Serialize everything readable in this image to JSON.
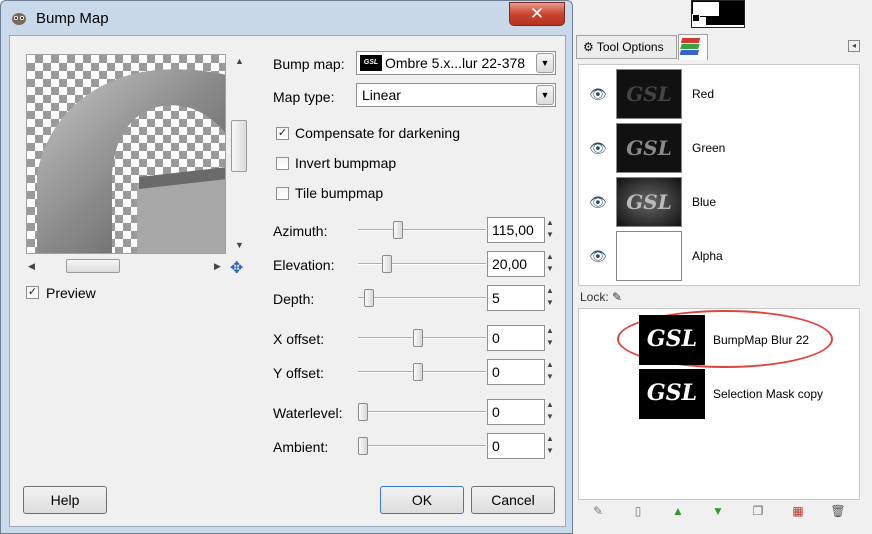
{
  "dialog": {
    "title": "Bump Map",
    "close_label": "✕",
    "preview_label": "Preview",
    "bump_map_label": "Bump map:",
    "bump_map_value": "Ombre 5.x...lur 22-378",
    "bump_thumb_text": "GSL",
    "map_type_label": "Map type:",
    "map_type_value": "Linear",
    "compensate_label": "Compensate for darkening",
    "invert_label": "Invert bumpmap",
    "tile_label": "Tile bumpmap",
    "azimuth_label": "Azimuth:",
    "azimuth_value": "115,00",
    "elevation_label": "Elevation:",
    "elevation_value": "20,00",
    "depth_label": "Depth:",
    "depth_value": "5",
    "xoffset_label": "X offset:",
    "xoffset_value": "0",
    "yoffset_label": "Y offset:",
    "yoffset_value": "0",
    "waterlevel_label": "Waterlevel:",
    "waterlevel_value": "0",
    "ambient_label": "Ambient:",
    "ambient_value": "0",
    "help_label": "Help",
    "ok_label": "OK",
    "cancel_label": "Cancel",
    "checks": {
      "preview": true,
      "compensate": true,
      "invert": false,
      "tile": false
    }
  },
  "panel": {
    "tab_tool_options": "Tool Options",
    "lock_label": "Lock:",
    "channels": [
      {
        "name": "Red"
      },
      {
        "name": "Green"
      },
      {
        "name": "Blue"
      },
      {
        "name": "Alpha"
      }
    ],
    "channel_thumb_text": "GSL",
    "layers": [
      {
        "name": "BumpMap Blur 22"
      },
      {
        "name": "Selection Mask copy"
      }
    ],
    "layer_thumb_text": "GSL"
  },
  "colors": {
    "accent_highlight": "#e0443f",
    "close_button": "#c7452f"
  }
}
